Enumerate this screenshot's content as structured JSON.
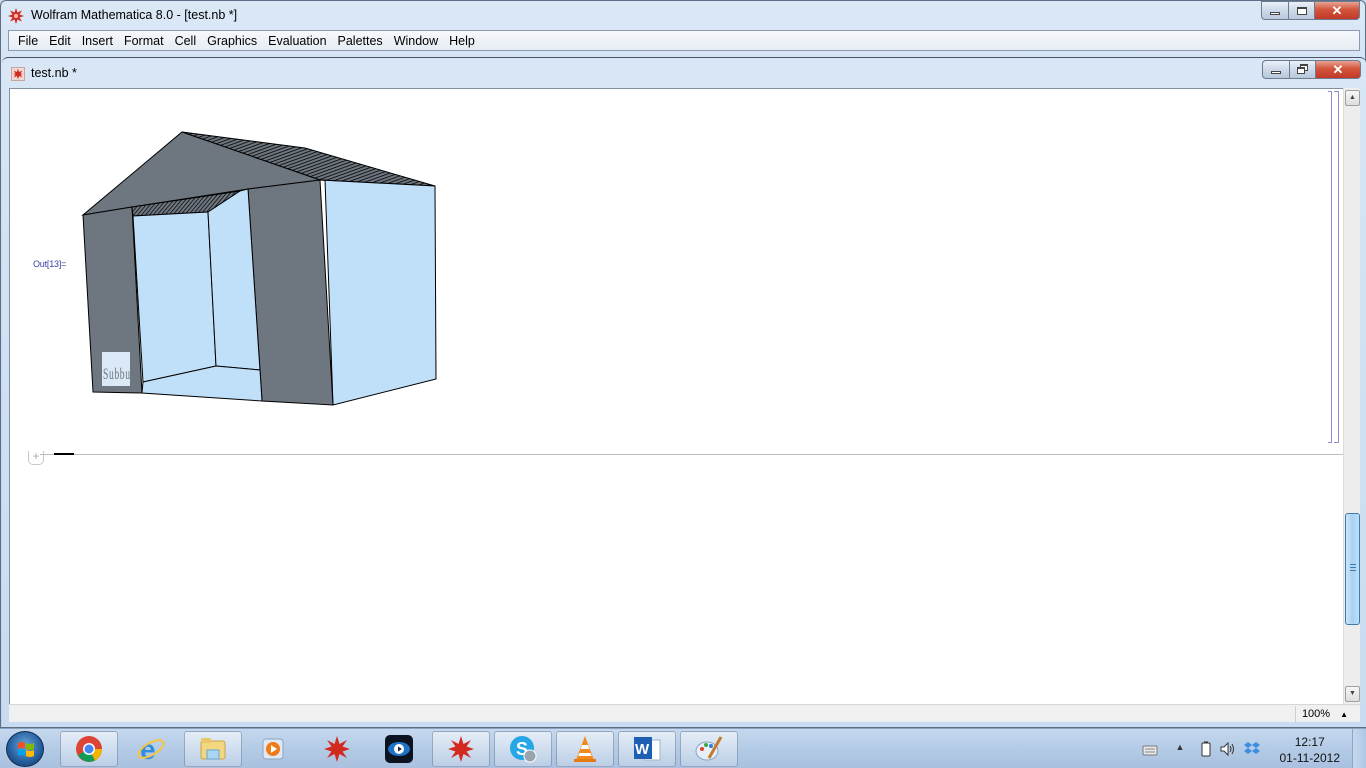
{
  "app": {
    "title": "Wolfram Mathematica 8.0 - [test.nb *]"
  },
  "menu": {
    "items": [
      {
        "label": "File"
      },
      {
        "label": "Edit"
      },
      {
        "label": "Insert"
      },
      {
        "label": "Format"
      },
      {
        "label": "Cell"
      },
      {
        "label": "Graphics"
      },
      {
        "label": "Evaluation"
      },
      {
        "label": "Palettes"
      },
      {
        "label": "Window"
      },
      {
        "label": "Help"
      }
    ]
  },
  "window_controls": {
    "minimize": "—",
    "close": "✕"
  },
  "notebook": {
    "title": "test.nb *",
    "output_label": "Out[13]=",
    "graphic_text": "Subbu",
    "insert_button": "+",
    "colors": {
      "wall": "#c0e0fa",
      "dark_wall": "#6e7680",
      "outline": "#000000"
    }
  },
  "statusbar": {
    "zoom": "100%",
    "zoom_caret": "▲"
  },
  "scrollbar": {
    "up": "▲",
    "down": "▼"
  },
  "taskbar": {
    "items": [
      {
        "name": "chrome",
        "open": true
      },
      {
        "name": "internet-explorer",
        "open": false
      },
      {
        "name": "windows-explorer",
        "open": true
      },
      {
        "name": "media-player",
        "open": false
      },
      {
        "name": "mathematica",
        "open": false
      },
      {
        "name": "media-center",
        "open": false
      },
      {
        "name": "mathematica-running",
        "open": true
      },
      {
        "name": "skype",
        "open": true
      },
      {
        "name": "vlc",
        "open": true
      },
      {
        "name": "word",
        "open": true
      },
      {
        "name": "paint",
        "open": true
      }
    ],
    "tray": {
      "show_hidden": "▲",
      "time": "12:17",
      "date": "01-11-2012"
    }
  }
}
